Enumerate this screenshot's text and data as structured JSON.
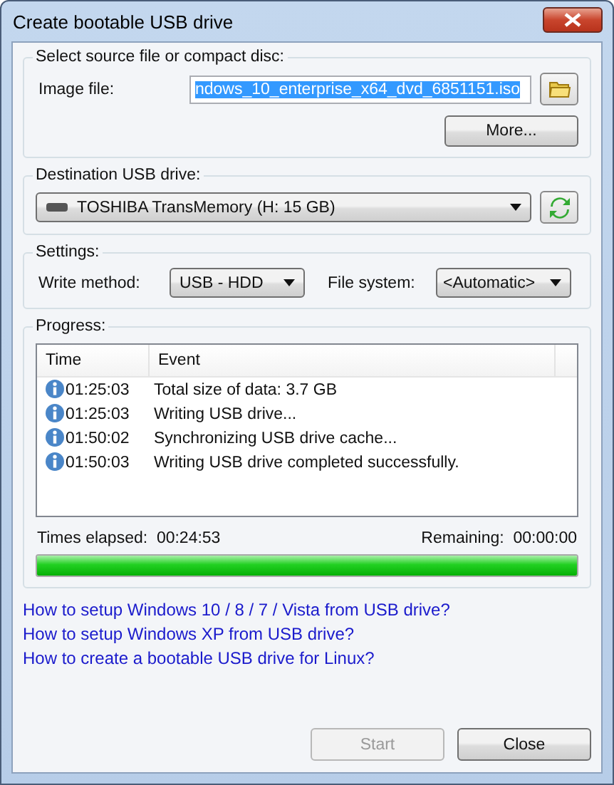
{
  "window": {
    "title": "Create bootable USB drive"
  },
  "source": {
    "heading": "Select source file or compact disc:",
    "label": "Image file:",
    "value": "ndows_10_enterprise_x64_dvd_6851151.iso",
    "value_selected": true,
    "more_button": "More..."
  },
  "destination": {
    "heading": "Destination USB drive:",
    "drive": "TOSHIBA TransMemory (H: 15 GB)"
  },
  "settings": {
    "heading": "Settings:",
    "write_method_label": "Write method:",
    "write_method": "USB - HDD",
    "file_system_label": "File system:",
    "file_system": "<Automatic>"
  },
  "progress": {
    "heading": "Progress:",
    "columns": [
      "Time",
      "Event"
    ],
    "rows": [
      {
        "time": "01:25:03",
        "event": "Total size of data: 3.7 GB"
      },
      {
        "time": "01:25:03",
        "event": "Writing USB drive..."
      },
      {
        "time": "01:50:02",
        "event": "Synchronizing USB drive cache..."
      },
      {
        "time": "01:50:03",
        "event": "Writing USB drive completed successfully."
      }
    ],
    "elapsed_label": "Times elapsed:",
    "elapsed": "00:24:53",
    "remaining_label": "Remaining:",
    "remaining": "00:00:00",
    "level": 1
  },
  "links": [
    "How to setup Windows 10 / 8 / 7 / Vista from USB drive?",
    "How to setup Windows XP from USB drive?",
    "How to create a bootable USB drive for Linux?"
  ],
  "buttons": [
    {
      "label": "Start",
      "disabled": true
    },
    {
      "label": "Close",
      "disabled": false
    }
  ]
}
